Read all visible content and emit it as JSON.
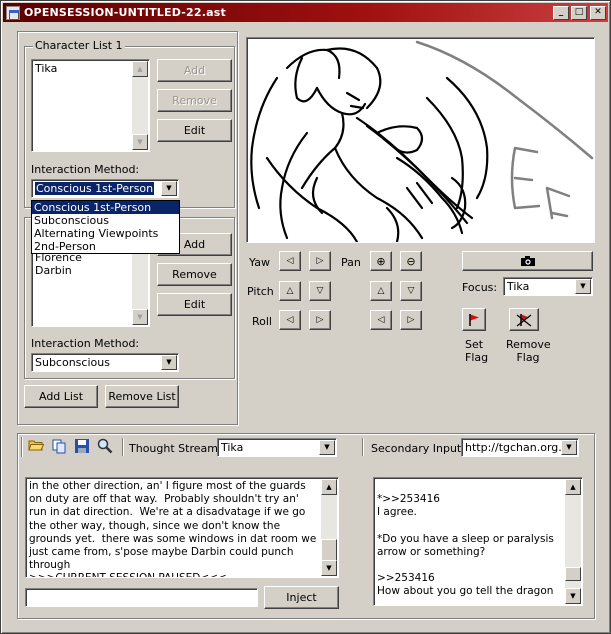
{
  "window": {
    "title": "OPENSESSION-UNTITLED-22.ast"
  },
  "character_list_1": {
    "label": "Character List 1",
    "items": [
      "Tika"
    ],
    "add_label": "Add",
    "remove_label": "Remove",
    "edit_label": "Edit",
    "interaction_label": "Interaction Method:",
    "interaction_value": "Conscious 1st-Person",
    "dropdown_options": [
      "Conscious 1st-Person",
      "Subconscious",
      "Alternating Viewpoints",
      "2nd-Person"
    ]
  },
  "character_list_2": {
    "items": [
      "Florence",
      "Darbin"
    ],
    "add_label": "Add",
    "remove_label": "Remove",
    "edit_label": "Edit",
    "interaction_label": "Interaction Method:",
    "interaction_value": "Subconscious"
  },
  "list_buttons": {
    "add_list": "Add List",
    "remove_list": "Remove List"
  },
  "camera": {
    "yaw_label": "Yaw",
    "pan_label": "Pan",
    "pitch_label": "Pitch",
    "roll_label": "Roll",
    "focus_label": "Focus:",
    "focus_value": "Tika",
    "set_flag_label": "Set Flag",
    "remove_flag_label": "Remove Flag"
  },
  "stream": {
    "thought_stream_label": "Thought Stream:",
    "thought_stream_value": "Tika",
    "secondary_input_label": "Secondary Input:",
    "secondary_input_value": "http://tgchan.org...",
    "main_text": "in the other direction, an' I figure most of the guards on duty are off that way.  Probably shouldn't try an' run in dat direction.  We're at a disadvatage if we go the other way, though, since we don't know the grounds yet.  there was some windows in dat room we just came from, s'pose maybe Darbin could punch through\n>>>CURRENT SESSION PAUSED<<<",
    "secondary_text": "*>>253416\nI agree.\n\n*Do you have a sleep or paralysis arrow or something?\n\n>>253416\nHow about you go tell the dragon",
    "input_value": "",
    "inject_label": "Inject"
  },
  "icons": {
    "open": "folder-open-icon",
    "copy": "copy-icon",
    "save": "save-icon",
    "search": "magnifier-icon",
    "camera": "camera-icon",
    "flag": "flag-icon",
    "remove_flag": "flag-remove-icon"
  },
  "colors": {
    "titlebar": "#8a1010",
    "selection": "#0a246a",
    "flag_red": "#d01010"
  }
}
